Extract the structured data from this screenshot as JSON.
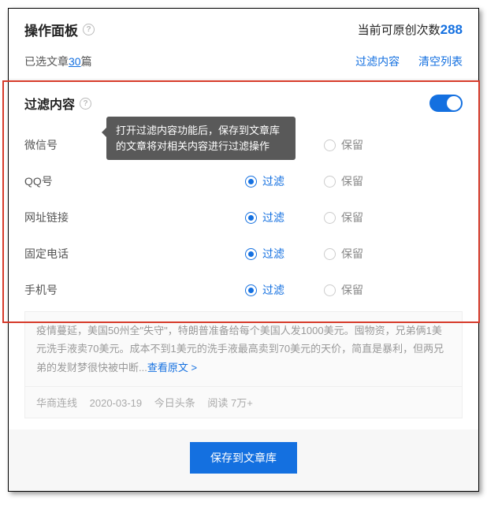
{
  "header": {
    "title": "操作面板",
    "remain_label": "当前可原创次数",
    "remain_count": "288"
  },
  "subheader": {
    "selected_prefix": "已选文章",
    "selected_count": "30",
    "selected_suffix": "篇",
    "link_filter": "过滤内容",
    "link_clear": "清空列表"
  },
  "filter": {
    "title": "过滤内容",
    "tooltip": "打开过滤内容功能后，保存到文章库的文章将对相关内容进行过滤操作",
    "opt_filter": "过滤",
    "opt_keep": "保留",
    "rows": [
      {
        "label": "微信号"
      },
      {
        "label": "QQ号"
      },
      {
        "label": "网址链接"
      },
      {
        "label": "固定电话"
      },
      {
        "label": "手机号"
      }
    ]
  },
  "article": {
    "text": "疫情蔓延，美国50州全\"失守\"，特朗普准备给每个美国人发1000美元。囤物资，兄弟俩1美元洗手液卖70美元。成本不到1美元的洗手液最高卖到70美元的天价，简直是暴利，但两兄弟的发财梦很快被中断...",
    "more": "查看原文 >",
    "source": "华商连线",
    "date": "2020-03-19",
    "platform": "今日头条",
    "reads": "阅读 7万+"
  },
  "footer": {
    "save": "保存到文章库"
  }
}
